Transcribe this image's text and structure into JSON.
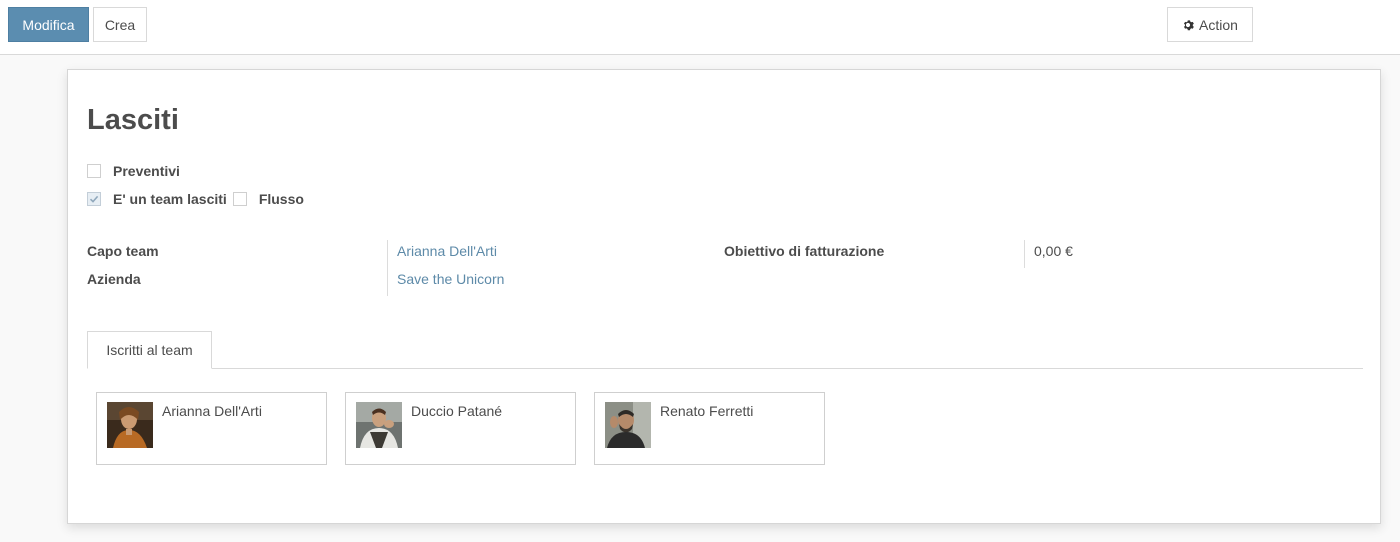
{
  "toolbar": {
    "edit_label": "Modifica",
    "create_label": "Crea",
    "action_label": "Action"
  },
  "form": {
    "title": "Lasciti",
    "checkboxes": {
      "quotations": {
        "label": "Preventivi",
        "checked": false
      },
      "bequest_team": {
        "label": "E' un team lasciti",
        "checked": true
      },
      "pipeline": {
        "label": "Flusso",
        "checked": false
      }
    },
    "fields": {
      "team_leader": {
        "label": "Capo team",
        "value": "Arianna Dell'Arti"
      },
      "company": {
        "label": "Azienda",
        "value": "Save the Unicorn"
      },
      "invoice_target": {
        "label": "Obiettivo di fatturazione",
        "value": "0,00 €"
      }
    },
    "tabs": [
      {
        "label": "Iscritti al team",
        "active": true
      }
    ],
    "members": [
      {
        "name": "Arianna Dell'Arti"
      },
      {
        "name": "Duccio Patané"
      },
      {
        "name": "Renato Ferretti"
      }
    ]
  },
  "colors": {
    "primary": "#5b8db0",
    "link": "#5d8aa8",
    "text": "#4c4c4c"
  }
}
